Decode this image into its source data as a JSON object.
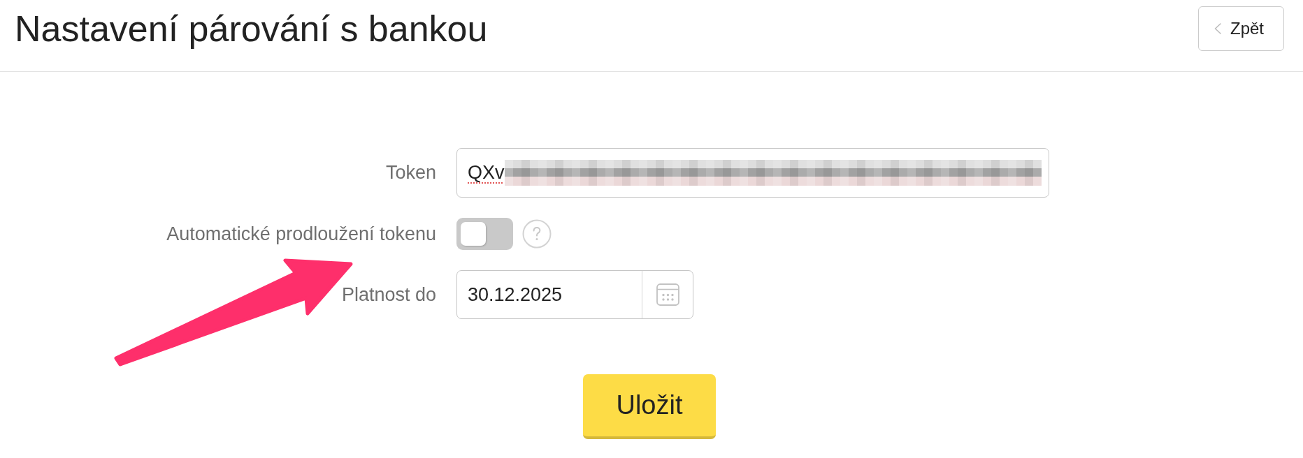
{
  "header": {
    "title": "Nastavení párování s bankou",
    "back_button": {
      "label": "Zpět"
    }
  },
  "form": {
    "fields": [
      {
        "kind": "text",
        "label": "Token",
        "value": "QXv",
        "spell_error": true,
        "redacted": true
      },
      {
        "kind": "toggle",
        "label": "Automatické prodloužení tokenu",
        "on": false,
        "help": true
      },
      {
        "kind": "date",
        "label": "Platnost do",
        "value": "30.12.2025"
      }
    ]
  },
  "save_button": {
    "label": "Uložit"
  },
  "annotation": {
    "kind": "arrow"
  }
}
